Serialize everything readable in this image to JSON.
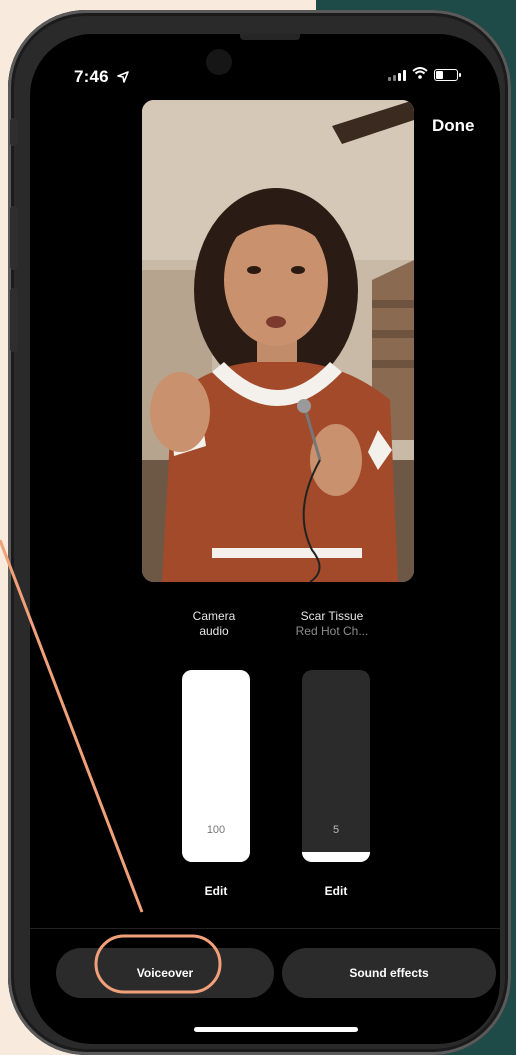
{
  "status_bar": {
    "time": "7:46",
    "location_icon": "location-arrow-icon",
    "signal_icon": "cellular-signal-icon",
    "wifi_icon": "wifi-icon",
    "battery_icon": "battery-icon"
  },
  "header": {
    "done_label": "Done"
  },
  "mixer": {
    "camera": {
      "title_line1": "Camera",
      "title_line2": "audio",
      "value": "100",
      "level_fraction": 1.0,
      "edit_label": "Edit"
    },
    "music": {
      "title_line1": "Scar Tissue",
      "title_line2": "Red Hot Ch...",
      "value": "5",
      "level_fraction": 0.05,
      "edit_label": "Edit"
    }
  },
  "bottom_actions": {
    "voiceover_label": "Voiceover",
    "sound_effects_label": "Sound effects"
  },
  "colors": {
    "background": "#f8ebde",
    "accent_panel": "#1e4a48",
    "annotation": "#f1a17a",
    "slider_fill": "#ffffff",
    "slider_track": "#2b2b2b"
  }
}
